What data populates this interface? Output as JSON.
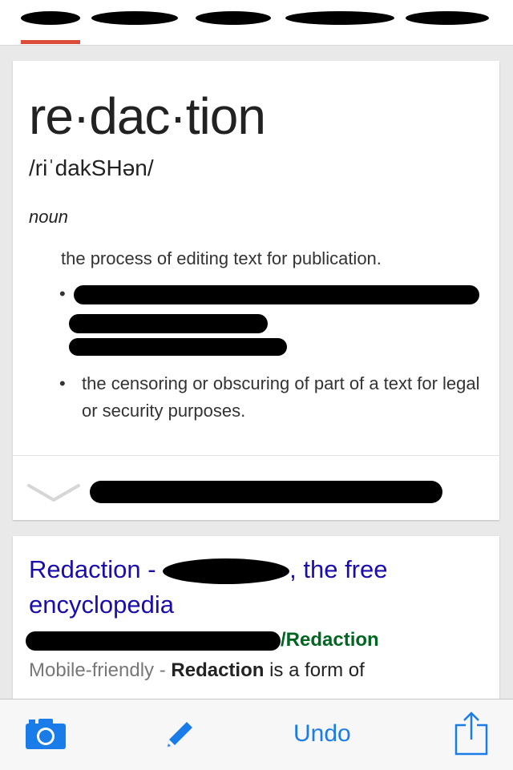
{
  "tabs": {
    "active_index": 0,
    "accent_color": "#dd4b39",
    "count": 5
  },
  "dictionary": {
    "word": "re·dac·tion",
    "phonetic": "/riˈdakSHən/",
    "part_of_speech": "noun",
    "definition_main": "the process of editing text for publication.",
    "definition_2": "the censoring or obscuring of part of a text for legal or security purposes."
  },
  "result": {
    "title_prefix": "Redaction - ",
    "title_suffix": ", the free encyclopedia",
    "url_suffix": "/Redaction",
    "snippet_label": "Mobile-friendly - ",
    "snippet_bold": "Redaction",
    "snippet_text": " is a form of"
  },
  "toolbar": {
    "undo_label": "Undo",
    "accent_color": "#1a7ce8",
    "icons": [
      "camera-icon",
      "pencil-icon",
      "share-icon"
    ]
  }
}
